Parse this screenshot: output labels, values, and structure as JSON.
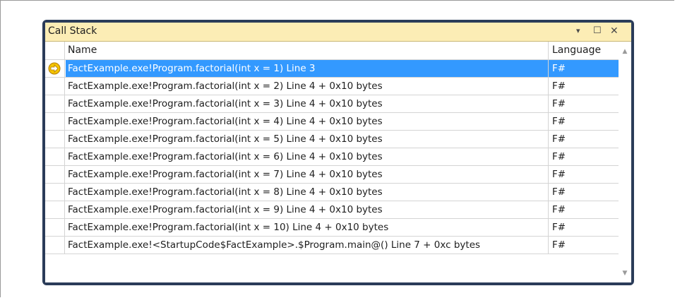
{
  "window": {
    "title": "Call Stack",
    "dropdown_glyph": "▾",
    "maximize_glyph": "☐",
    "close_glyph": "✕"
  },
  "columns": {
    "name": "Name",
    "language": "Language"
  },
  "rows": [
    {
      "name": "FactExample.exe!Program.factorial(int x = 1) Line 3",
      "language": "F#",
      "current": true
    },
    {
      "name": "FactExample.exe!Program.factorial(int x = 2) Line 4 + 0x10 bytes",
      "language": "F#"
    },
    {
      "name": "FactExample.exe!Program.factorial(int x = 3) Line 4 + 0x10 bytes",
      "language": "F#"
    },
    {
      "name": "FactExample.exe!Program.factorial(int x = 4) Line 4 + 0x10 bytes",
      "language": "F#"
    },
    {
      "name": "FactExample.exe!Program.factorial(int x = 5) Line 4 + 0x10 bytes",
      "language": "F#"
    },
    {
      "name": "FactExample.exe!Program.factorial(int x = 6) Line 4 + 0x10 bytes",
      "language": "F#"
    },
    {
      "name": "FactExample.exe!Program.factorial(int x = 7) Line 4 + 0x10 bytes",
      "language": "F#"
    },
    {
      "name": "FactExample.exe!Program.factorial(int x = 8) Line 4 + 0x10 bytes",
      "language": "F#"
    },
    {
      "name": "FactExample.exe!Program.factorial(int x = 9) Line 4 + 0x10 bytes",
      "language": "F#"
    },
    {
      "name": "FactExample.exe!Program.factorial(int x = 10) Line 4 + 0x10 bytes",
      "language": "F#"
    },
    {
      "name": "FactExample.exe!<StartupCode$FactExample>.$Program.main@() Line 7 + 0xc bytes",
      "language": "F#"
    }
  ],
  "colors": {
    "frame": "#2b3c59",
    "titlebar": "#fcedb5",
    "selection": "#3399ff",
    "arrow_fill": "#f5c400"
  },
  "icons": {
    "current_frame": "yellow-arrow-icon",
    "scroll_up": "scroll-up-icon",
    "scroll_down": "scroll-down-icon"
  }
}
